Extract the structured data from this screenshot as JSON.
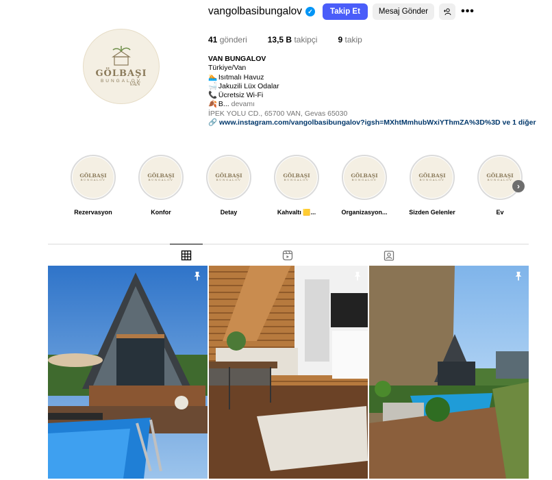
{
  "profile": {
    "username": "vangolbasibungalov",
    "verified": true,
    "follow_label": "Takip Et",
    "message_label": "Mesaj Gönder",
    "add_user_icon": "add-user-icon",
    "more_icon": "more-icon",
    "avatar_logo": {
      "line1": "GÖLBAŞI",
      "line2": "BUNGALOV",
      "line3": "VAN"
    }
  },
  "stats": [
    {
      "value": "41",
      "label": "gönderi"
    },
    {
      "value": "13,5 B",
      "label": "takipçi"
    },
    {
      "value": "9",
      "label": "takip"
    }
  ],
  "bio": {
    "name": "VAN BUNGALOV",
    "location": "Türkiye/Van",
    "lines": [
      {
        "emoji": "🏊",
        "text": "Isıtmalı Havuz"
      },
      {
        "emoji": "🛁",
        "text": "Jakuzili Lüx Odalar"
      },
      {
        "emoji": "📞",
        "text": "Ücretsiz Wi-Fi"
      },
      {
        "emoji": "🍂",
        "text": "B..."
      }
    ],
    "more_label": "devamı",
    "address": "İPEK YOLU CD., 65700 VAN, Gevas 65030",
    "link": "www.instagram.com/vangolbasibungalov?igsh=MXhtMmhubWxiYThmZA%3D%3D ve 1 diğer"
  },
  "highlights": [
    {
      "label": "Rezervasyon"
    },
    {
      "label": "Konfor"
    },
    {
      "label": "Detay"
    },
    {
      "label": "Kahvaltı 🟨..."
    },
    {
      "label": "Organizasyon..."
    },
    {
      "label": "Sizden Gelenler"
    },
    {
      "label": "Ev"
    }
  ],
  "tabs": [
    {
      "icon": "grid-icon",
      "active": true
    },
    {
      "icon": "reels-icon",
      "active": false
    },
    {
      "icon": "tagged-icon",
      "active": false
    }
  ],
  "posts": [
    {
      "description": "a-frame bungalow with pool",
      "pinned": true
    },
    {
      "description": "wooden interior with stairs",
      "pinned": true
    },
    {
      "description": "garden pool with bungalow",
      "pinned": true
    }
  ],
  "colors": {
    "accent": "#4a5df9",
    "verified": "#0095f6",
    "link": "#00376b",
    "muted": "#737373"
  }
}
